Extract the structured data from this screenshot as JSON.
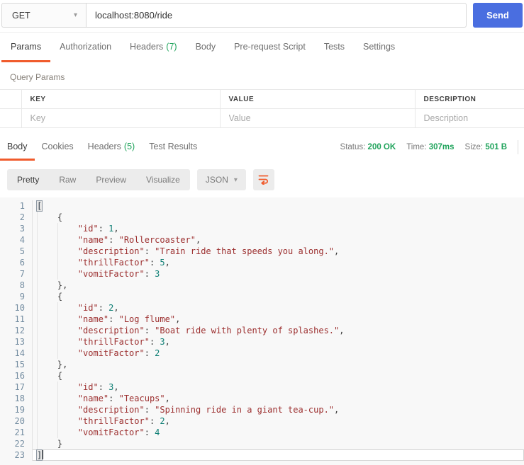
{
  "request": {
    "method": "GET",
    "url": "localhost:8080/ride",
    "send_label": "Send",
    "tabs": [
      {
        "label": "Params",
        "active": true
      },
      {
        "label": "Authorization"
      },
      {
        "label": "Headers",
        "count": "(7)"
      },
      {
        "label": "Body"
      },
      {
        "label": "Pre-request Script"
      },
      {
        "label": "Tests"
      },
      {
        "label": "Settings"
      }
    ],
    "query_params_label": "Query Params",
    "table": {
      "headers": [
        "KEY",
        "VALUE",
        "DESCRIPTION"
      ],
      "placeholder_row": {
        "key": "Key",
        "value": "Value",
        "description": "Description"
      }
    }
  },
  "response": {
    "tabs": [
      {
        "label": "Body",
        "active": true
      },
      {
        "label": "Cookies"
      },
      {
        "label": "Headers",
        "count": "(5)"
      },
      {
        "label": "Test Results"
      }
    ],
    "meta": [
      {
        "label": "Status:",
        "value": "200 OK"
      },
      {
        "label": "Time:",
        "value": "307ms"
      },
      {
        "label": "Size:",
        "value": "501 B"
      }
    ],
    "view_modes": [
      {
        "label": "Pretty",
        "active": true
      },
      {
        "label": "Raw"
      },
      {
        "label": "Preview"
      },
      {
        "label": "Visualize"
      }
    ],
    "format_select": "JSON",
    "code": {
      "lines": [
        {
          "tokens": [
            [
              "b",
              "["
            ]
          ]
        },
        {
          "tokens": [
            [
              "p",
              "    {"
            ]
          ]
        },
        {
          "tokens": [
            [
              "p",
              "        "
            ],
            [
              "k",
              "\"id\""
            ],
            [
              "p",
              ": "
            ],
            [
              "n",
              "1"
            ],
            [
              "p",
              ","
            ]
          ]
        },
        {
          "tokens": [
            [
              "p",
              "        "
            ],
            [
              "k",
              "\"name\""
            ],
            [
              "p",
              ": "
            ],
            [
              "s",
              "\"Rollercoaster\""
            ],
            [
              "p",
              ","
            ]
          ]
        },
        {
          "tokens": [
            [
              "p",
              "        "
            ],
            [
              "k",
              "\"description\""
            ],
            [
              "p",
              ": "
            ],
            [
              "s",
              "\"Train ride that speeds you along.\""
            ],
            [
              "p",
              ","
            ]
          ]
        },
        {
          "tokens": [
            [
              "p",
              "        "
            ],
            [
              "k",
              "\"thrillFactor\""
            ],
            [
              "p",
              ": "
            ],
            [
              "n",
              "5"
            ],
            [
              "p",
              ","
            ]
          ]
        },
        {
          "tokens": [
            [
              "p",
              "        "
            ],
            [
              "k",
              "\"vomitFactor\""
            ],
            [
              "p",
              ": "
            ],
            [
              "n",
              "3"
            ]
          ]
        },
        {
          "tokens": [
            [
              "p",
              "    },"
            ]
          ]
        },
        {
          "tokens": [
            [
              "p",
              "    {"
            ]
          ]
        },
        {
          "tokens": [
            [
              "p",
              "        "
            ],
            [
              "k",
              "\"id\""
            ],
            [
              "p",
              ": "
            ],
            [
              "n",
              "2"
            ],
            [
              "p",
              ","
            ]
          ]
        },
        {
          "tokens": [
            [
              "p",
              "        "
            ],
            [
              "k",
              "\"name\""
            ],
            [
              "p",
              ": "
            ],
            [
              "s",
              "\"Log flume\""
            ],
            [
              "p",
              ","
            ]
          ]
        },
        {
          "tokens": [
            [
              "p",
              "        "
            ],
            [
              "k",
              "\"description\""
            ],
            [
              "p",
              ": "
            ],
            [
              "s",
              "\"Boat ride with plenty of splashes.\""
            ],
            [
              "p",
              ","
            ]
          ]
        },
        {
          "tokens": [
            [
              "p",
              "        "
            ],
            [
              "k",
              "\"thrillFactor\""
            ],
            [
              "p",
              ": "
            ],
            [
              "n",
              "3"
            ],
            [
              "p",
              ","
            ]
          ]
        },
        {
          "tokens": [
            [
              "p",
              "        "
            ],
            [
              "k",
              "\"vomitFactor\""
            ],
            [
              "p",
              ": "
            ],
            [
              "n",
              "2"
            ]
          ]
        },
        {
          "tokens": [
            [
              "p",
              "    },"
            ]
          ]
        },
        {
          "tokens": [
            [
              "p",
              "    {"
            ]
          ]
        },
        {
          "tokens": [
            [
              "p",
              "        "
            ],
            [
              "k",
              "\"id\""
            ],
            [
              "p",
              ": "
            ],
            [
              "n",
              "3"
            ],
            [
              "p",
              ","
            ]
          ]
        },
        {
          "tokens": [
            [
              "p",
              "        "
            ],
            [
              "k",
              "\"name\""
            ],
            [
              "p",
              ": "
            ],
            [
              "s",
              "\"Teacups\""
            ],
            [
              "p",
              ","
            ]
          ]
        },
        {
          "tokens": [
            [
              "p",
              "        "
            ],
            [
              "k",
              "\"description\""
            ],
            [
              "p",
              ": "
            ],
            [
              "s",
              "\"Spinning ride in a giant tea-cup.\""
            ],
            [
              "p",
              ","
            ]
          ]
        },
        {
          "tokens": [
            [
              "p",
              "        "
            ],
            [
              "k",
              "\"thrillFactor\""
            ],
            [
              "p",
              ": "
            ],
            [
              "n",
              "2"
            ],
            [
              "p",
              ","
            ]
          ]
        },
        {
          "tokens": [
            [
              "p",
              "        "
            ],
            [
              "k",
              "\"vomitFactor\""
            ],
            [
              "p",
              ": "
            ],
            [
              "n",
              "4"
            ]
          ]
        },
        {
          "tokens": [
            [
              "p",
              "    }"
            ]
          ]
        },
        {
          "tokens": [
            [
              "b",
              "]"
            ]
          ],
          "active": true,
          "cursor": true
        }
      ]
    }
  },
  "colors": {
    "accent_orange": "#f05b2c",
    "status_green": "#1fa35b",
    "send_blue": "#4a6ee0",
    "json_key": "#9c2f2f",
    "json_string": "#9c2f2f",
    "json_number": "#0f7f75",
    "line_number": "#748da1"
  }
}
